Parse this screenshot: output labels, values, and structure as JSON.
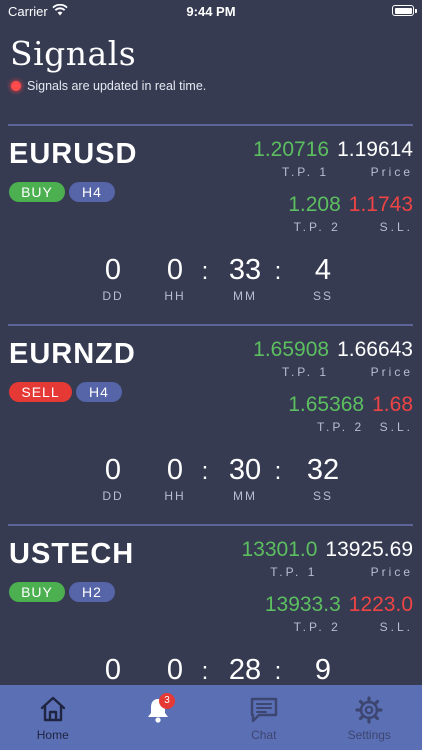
{
  "status_bar": {
    "carrier": "Carrier",
    "time": "9:44 PM"
  },
  "header": {
    "title": "Signals",
    "subtitle": "Signals are updated in real time."
  },
  "signals": [
    {
      "symbol": "EURUSD",
      "direction": "BUY",
      "timeframe": "H4",
      "tp1": "1.20716",
      "price": "1.19614",
      "tp2": "1.208",
      "sl": "1.1743",
      "timer": {
        "dd": "0",
        "hh": "0",
        "mm": "33",
        "ss": "4"
      }
    },
    {
      "symbol": "EURNZD",
      "direction": "SELL",
      "timeframe": "H4",
      "tp1": "1.65908",
      "price": "1.66643",
      "tp2": "1.65368",
      "sl": "1.68",
      "timer": {
        "dd": "0",
        "hh": "0",
        "mm": "30",
        "ss": "32"
      }
    },
    {
      "symbol": "USTECH",
      "direction": "BUY",
      "timeframe": "H2",
      "tp1": "13301.0",
      "price": "13925.69",
      "tp2": "13933.3",
      "sl": "1223.0",
      "timer": {
        "dd": "0",
        "hh": "0",
        "mm": "28",
        "ss": "9"
      }
    }
  ],
  "labels": {
    "tp1": "T.P. 1",
    "price": "Price",
    "tp2": "T.P. 2",
    "sl": "S.L.",
    "dd": "DD",
    "hh": "HH",
    "mm": "MM",
    "ss": "SS",
    "colon": ":"
  },
  "tab_bar": {
    "home": "Home",
    "notifications_badge": "3",
    "chat": "Chat",
    "settings": "Settings"
  },
  "colors": {
    "background": "#363b52",
    "tab_bar": "#5b6fb5",
    "buy": "#4caf50",
    "sell": "#e53935",
    "timeframe": "#5565a8",
    "take_profit": "#5cbf5f",
    "stop_loss": "#ef4444"
  },
  "icons": [
    "wifi-icon",
    "battery-icon",
    "live-indicator-icon",
    "home-icon",
    "bell-icon",
    "chat-icon",
    "gear-icon"
  ]
}
